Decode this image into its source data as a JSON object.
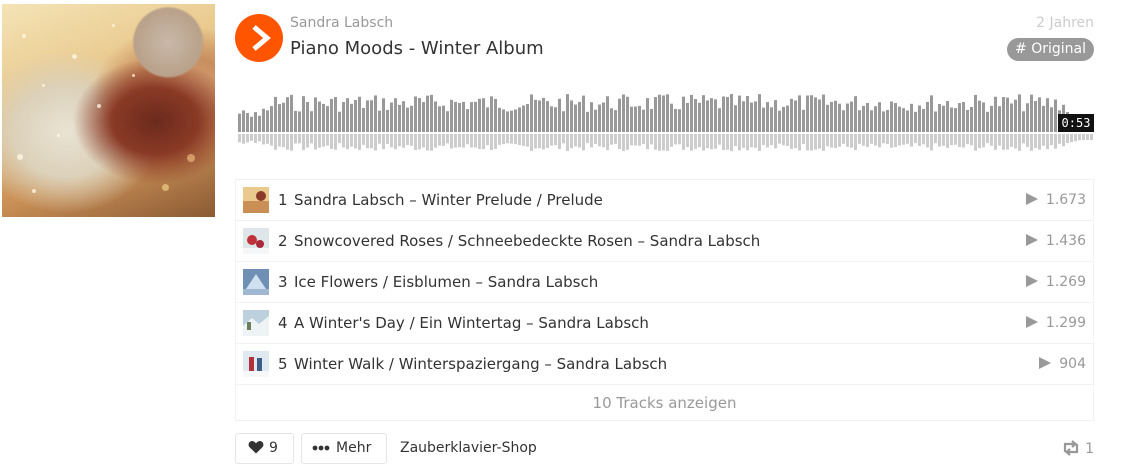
{
  "sound": {
    "artist": "Sandra Labsch",
    "title": "Piano Moods - Winter Album",
    "age": "2 Jahren",
    "tag": "# Original",
    "duration": "0:53",
    "play_icon": "play-icon",
    "accent_color": "#ff5500"
  },
  "tracks": [
    {
      "num": "1",
      "name": "Sandra Labsch – Winter Prelude / Prelude",
      "plays": "1.673"
    },
    {
      "num": "2",
      "name": "Snowcovered Roses / Schneebedeckte Rosen – Sandra Labsch",
      "plays": "1.436"
    },
    {
      "num": "3",
      "name": "Ice Flowers / Eisblumen – Sandra Labsch",
      "plays": "1.269"
    },
    {
      "num": "4",
      "name": "A Winter's Day / Ein Wintertag – Sandra Labsch",
      "plays": "1.299"
    },
    {
      "num": "5",
      "name": "Winter Walk / Winterspaziergang – Sandra Labsch",
      "plays": "904"
    }
  ],
  "show_all_label": "10 Tracks anzeigen",
  "footer": {
    "like_count": "9",
    "like_icon": "heart-icon",
    "more_label": "Mehr",
    "more_icon": "ellipsis-icon",
    "shop_label": "Zauberklavier-Shop",
    "repost_count": "1",
    "repost_icon": "repost-icon"
  }
}
